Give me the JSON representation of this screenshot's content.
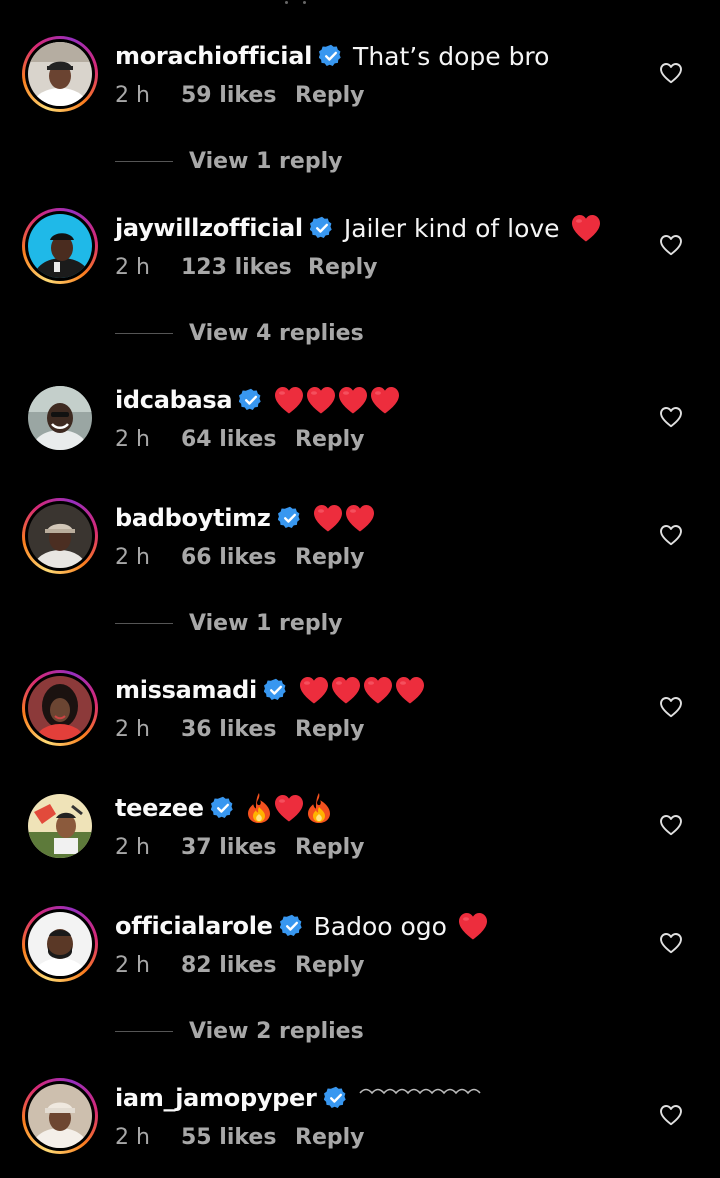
{
  "colors": {
    "background": "#000000",
    "username": "#fafafa",
    "meta": "#a8a8a8",
    "verified_badge": "#3897f0",
    "heart": "#ed2d3d"
  },
  "comments": [
    {
      "username": "morachiofficial",
      "text": "That’s dope bro",
      "emojis": [],
      "time": "2 h",
      "likes": "59 likes",
      "reply": "Reply",
      "view_replies": "View 1 reply",
      "verified": true,
      "story_ring": true
    },
    {
      "username": "jaywillzofficial",
      "text": "Jailer kind of love",
      "emojis": [
        "red-heart"
      ],
      "time": "2 h",
      "likes": "123 likes",
      "reply": "Reply",
      "view_replies": "View 4 replies",
      "verified": true,
      "story_ring": true
    },
    {
      "username": "idcabasa",
      "text": "",
      "emojis": [
        "red-heart",
        "red-heart",
        "red-heart",
        "red-heart"
      ],
      "time": "2 h",
      "likes": "64 likes",
      "reply": "Reply",
      "verified": true,
      "story_ring": false
    },
    {
      "username": "badboytimz",
      "text": "",
      "emojis": [
        "red-heart",
        "red-heart"
      ],
      "time": "2 h",
      "likes": "66 likes",
      "reply": "Reply",
      "view_replies": "View 1 reply",
      "verified": true,
      "story_ring": true
    },
    {
      "username": "missamadi",
      "text": "",
      "emojis": [
        "red-heart",
        "red-heart",
        "red-heart",
        "red-heart"
      ],
      "time": "2 h",
      "likes": "36 likes",
      "reply": "Reply",
      "verified": true,
      "story_ring": true
    },
    {
      "username": "teezee",
      "text": "",
      "emojis": [
        "fire",
        "red-heart",
        "fire"
      ],
      "time": "2 h",
      "likes": "37 likes",
      "reply": "Reply",
      "verified": true,
      "story_ring": false
    },
    {
      "username": "officialarole",
      "text": "Badoo ogo",
      "emojis": [
        "red-heart"
      ],
      "time": "2 h",
      "likes": "82 likes",
      "reply": "Reply",
      "view_replies": "View 2 replies",
      "verified": true,
      "story_ring": true
    },
    {
      "username": "iam_jamopyper",
      "text": "",
      "emojis": [
        "squiggle"
      ],
      "time": "2 h",
      "likes": "55 likes",
      "reply": "Reply",
      "verified": true,
      "story_ring": true
    }
  ]
}
